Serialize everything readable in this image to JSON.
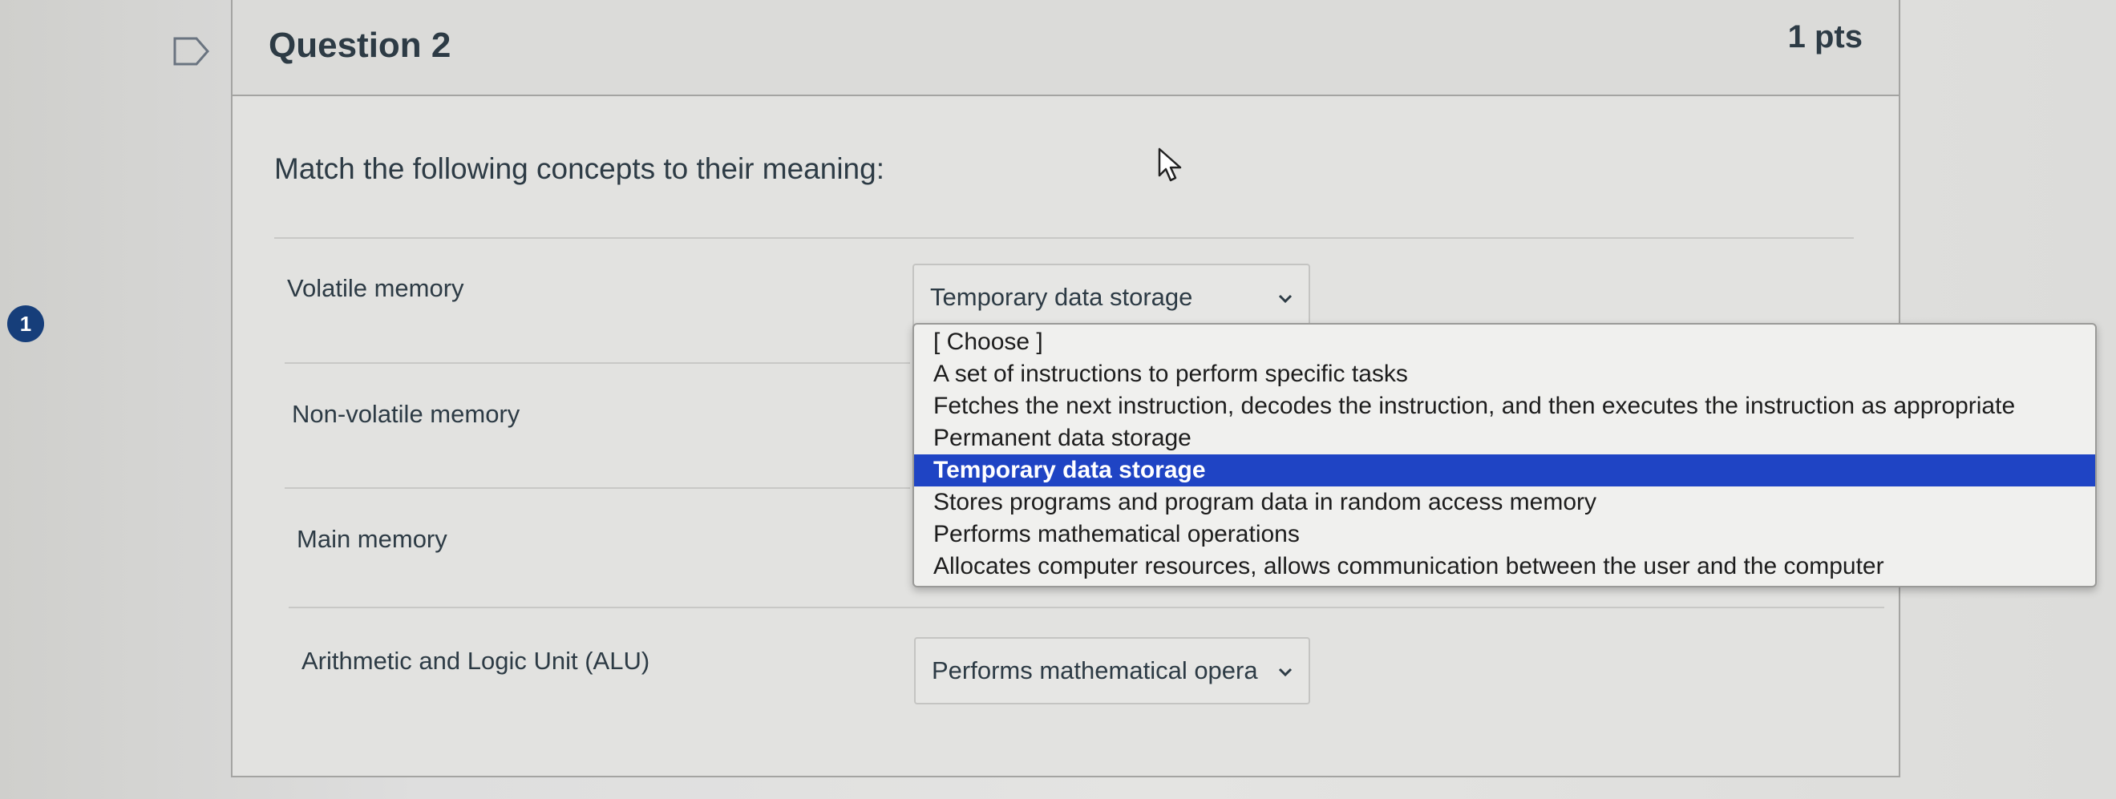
{
  "question": {
    "title": "Question 2",
    "points": "1 pts",
    "prompt": "Match the following concepts to their meaning:"
  },
  "step_badge": "1",
  "matches": [
    {
      "label": "Volatile memory",
      "selected": "Temporary data storage"
    },
    {
      "label": "Non-volatile memory",
      "selected": ""
    },
    {
      "label": "Main memory",
      "selected": ""
    },
    {
      "label": "Arithmetic and Logic Unit (ALU)",
      "selected": "Performs mathematical opera"
    }
  ],
  "dropdown": {
    "selected_option": "Temporary data storage",
    "options": [
      "[ Choose ]",
      "A set of instructions to perform specific tasks",
      "Fetches the next instruction, decodes the instruction, and then executes the instruction as appropriate",
      "Permanent data storage",
      "Temporary data storage",
      "Stores programs and program data in random access memory",
      "Performs mathematical operations",
      "Allocates computer resources, allows communication between the user and the computer"
    ]
  },
  "colors": {
    "highlight": "#1f44c4",
    "badge": "#163e7a",
    "text": "#2d3b45"
  },
  "icons": {
    "flag": "flag-icon",
    "chevron": "chevron-down-icon",
    "cursor": "mouse-pointer-icon"
  }
}
